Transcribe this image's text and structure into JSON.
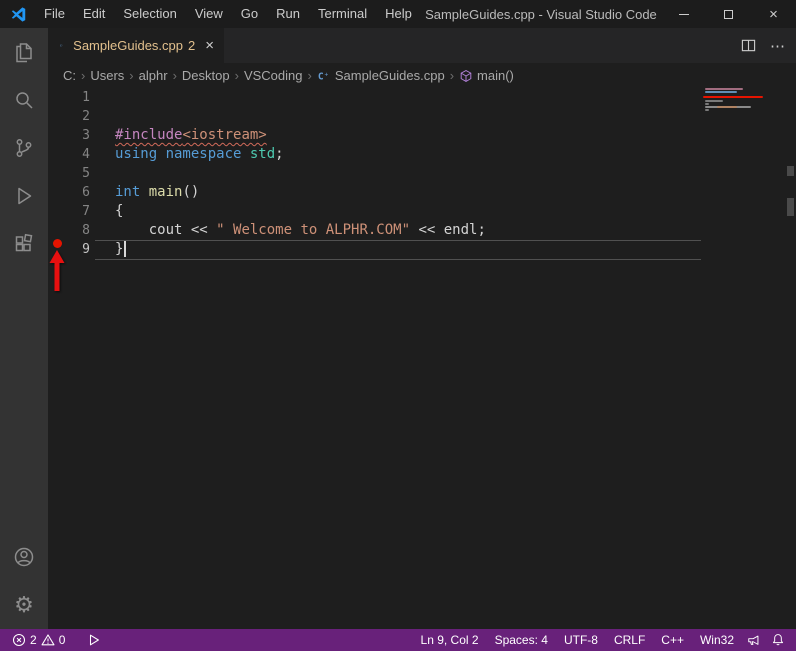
{
  "title_bar": {
    "title": "SampleGuides.cpp - Visual Studio Code",
    "menus": [
      "File",
      "Edit",
      "Selection",
      "View",
      "Go",
      "Run",
      "Terminal",
      "Help"
    ],
    "window_controls": {
      "close_glyph": "×"
    }
  },
  "tab_bar": {
    "tab": {
      "name": "SampleGuides.cpp",
      "badge": "2",
      "close_glyph": "×"
    },
    "more_actions_glyph": "⋯"
  },
  "breadcrumb": {
    "separator": "›",
    "items": [
      "C:",
      "Users",
      "alphr",
      "Desktop",
      "VSCoding",
      "SampleGuides.cpp",
      "main()"
    ]
  },
  "editor": {
    "lines": [
      {
        "number": "1",
        "tokens": []
      },
      {
        "number": "2",
        "tokens": []
      },
      {
        "number": "3",
        "tokens": [
          {
            "text": "#include"
          },
          {
            "text": "<iostream>"
          }
        ]
      },
      {
        "number": "4",
        "tokens": [
          {
            "text": "using namespace "
          },
          {
            "text": "std"
          },
          {
            "text": ";"
          }
        ]
      },
      {
        "number": "5",
        "tokens": []
      },
      {
        "number": "6",
        "tokens": [
          {
            "text": "int "
          },
          {
            "text": "main"
          },
          {
            "text": "()"
          }
        ]
      },
      {
        "number": "7",
        "tokens": [
          {
            "text": "{"
          }
        ]
      },
      {
        "number": "8",
        "tokens": [
          {
            "text": "    cout << "
          },
          {
            "text": "\" Welcome to ALPHR.COM\""
          },
          {
            "text": " << endl;"
          }
        ]
      },
      {
        "number": "9",
        "tokens": [
          {
            "text": "}"
          }
        ]
      }
    ]
  },
  "status_bar": {
    "errors": "2",
    "warnings": "0",
    "cursor_position": "Ln 9, Col 2",
    "indentation": "Spaces: 4",
    "encoding": "UTF-8",
    "eol": "CRLF",
    "language": "C++",
    "platform": "Win32"
  },
  "icons": {
    "gear": "⚙",
    "activity_bar": [
      "explorer-icon",
      "search-icon",
      "source-control-icon",
      "run-and-debug-icon",
      "extensions-icon",
      "accounts-icon",
      "settings-gear-icon"
    ],
    "status_bar": [
      "error-circle-icon",
      "warning-triangle-icon",
      "run-status-icon",
      "feedback-megaphone-icon",
      "notifications-bell-icon"
    ]
  },
  "colors": {
    "status_bar": "#68217a",
    "breakpoint_red": "#e51400",
    "tab_label": "#e2c08d",
    "error_squiggle": "#d16a5a"
  }
}
